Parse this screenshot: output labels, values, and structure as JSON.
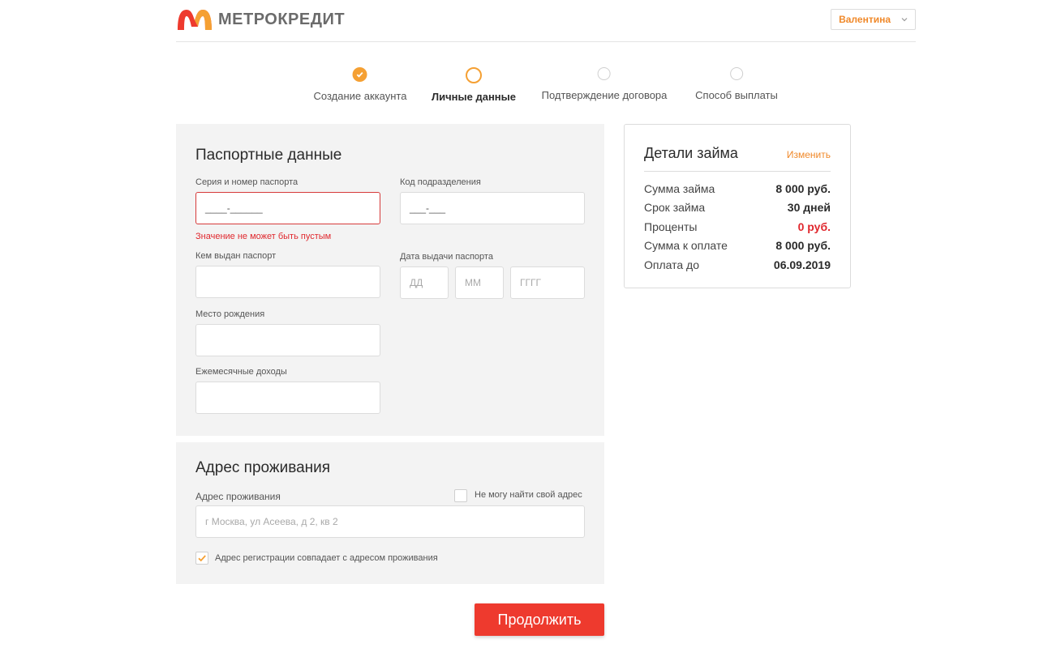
{
  "brand": {
    "name": "МЕТРОКРЕДИТ",
    "color_primary": "#ee3a2e",
    "color_accent": "#f5a033"
  },
  "header": {
    "user_menu": {
      "selected": "Валентина",
      "icon": "chevron-down-icon"
    }
  },
  "stepper": {
    "steps": [
      {
        "label": "Создание аккаунта",
        "state": "done"
      },
      {
        "label": "Личные данные",
        "state": "active"
      },
      {
        "label": "Подтверждение договора",
        "state": "pending"
      },
      {
        "label": "Способ выплаты",
        "state": "pending"
      }
    ]
  },
  "passport": {
    "title": "Паспортные данные",
    "series_number": {
      "label": "Серия и номер паспорта",
      "value": "____-______",
      "error": "Значение не может быть пустым"
    },
    "division_code": {
      "label": "Код подразделения",
      "value": "___-___"
    },
    "issued_by": {
      "label": "Кем выдан паспорт",
      "value": ""
    },
    "issue_date": {
      "label": "Дата выдачи паспорта",
      "day_placeholder": "ДД",
      "month_placeholder": "ММ",
      "year_placeholder": "ГГГГ"
    },
    "birth_place": {
      "label": "Место рождения",
      "value": ""
    },
    "monthly_income": {
      "label": "Ежемесячные доходы",
      "value": ""
    }
  },
  "address": {
    "title": "Адрес проживания",
    "field": {
      "label": "Адрес проживания",
      "placeholder": "г Москва, ул Асеева, д 2, кв 2"
    },
    "cant_find": {
      "label": "Не могу найти свой адрес",
      "checked": false
    },
    "same_registration": {
      "label": "Адрес регистрации совпадает с адресом проживания",
      "checked": true
    }
  },
  "loan": {
    "title": "Детали займа",
    "change_label": "Изменить",
    "rows": [
      {
        "key": "Сумма займа",
        "value": "8 000 руб."
      },
      {
        "key": "Срок займа",
        "value": "30 дней"
      },
      {
        "key": "Проценты",
        "value": "0 руб.",
        "highlight": "#e0282e"
      },
      {
        "key": "Сумма к оплате",
        "value": "8 000 руб."
      },
      {
        "key": "Оплата до",
        "value": "06.09.2019"
      }
    ]
  },
  "actions": {
    "continue_label": "Продолжить"
  }
}
